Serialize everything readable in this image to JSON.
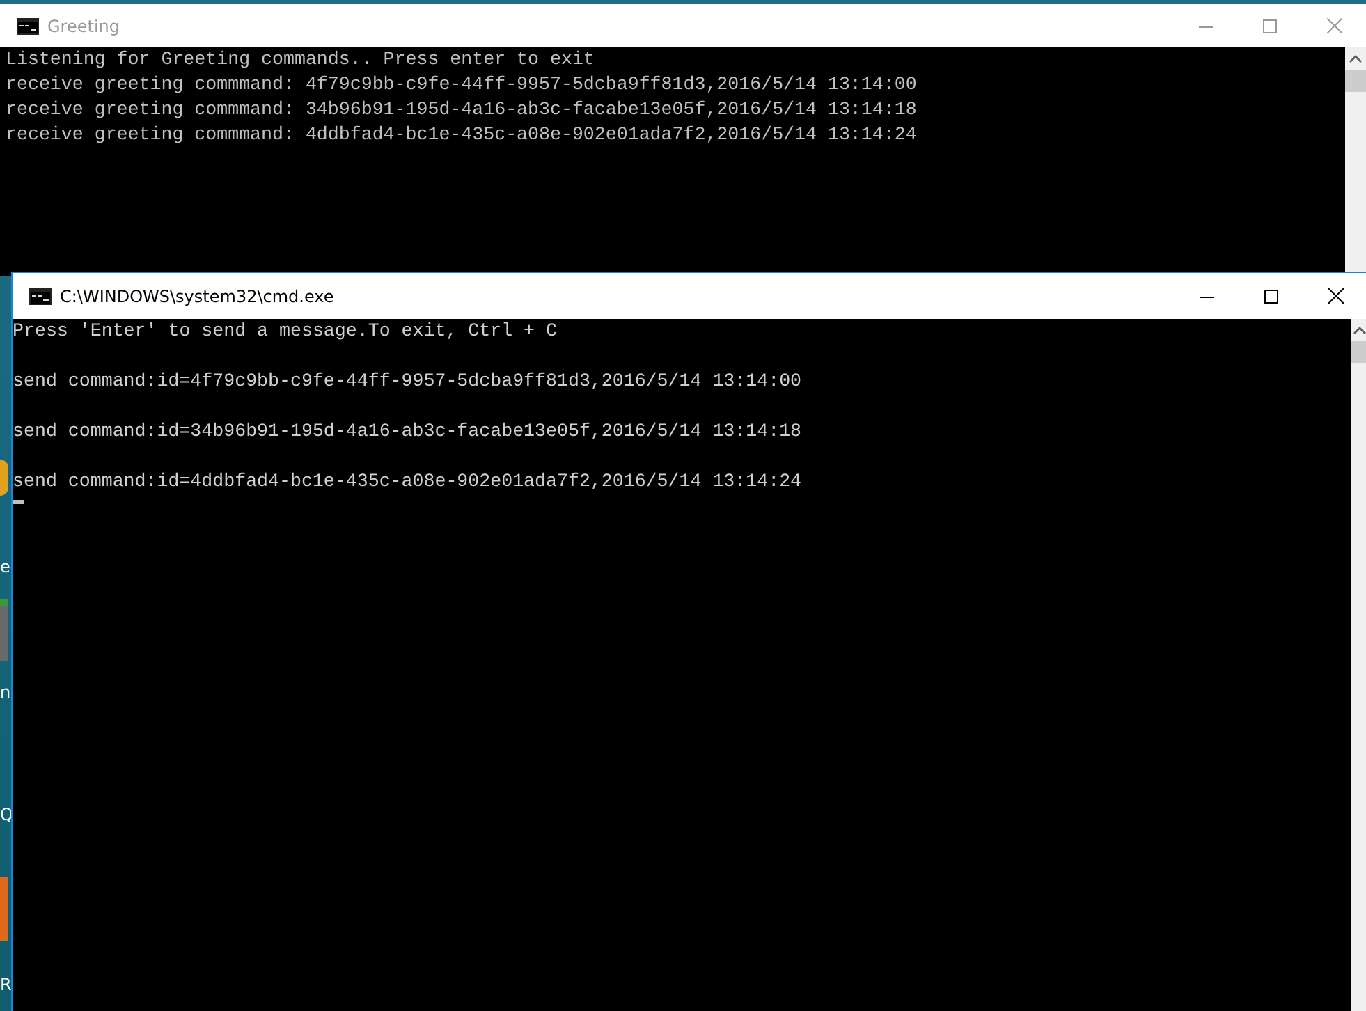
{
  "desktop": {
    "labels": [
      {
        "text": "e"
      },
      {
        "text": "n"
      },
      {
        "text": "Q"
      },
      {
        "text": "R"
      }
    ]
  },
  "windows": [
    {
      "title": "Greeting",
      "active": false,
      "lines": [
        {
          "text": "Listening for Greeting commands.. Press enter to exit",
          "blank_before": false
        },
        {
          "text": "receive greeting commmand: 4f79c9bb-c9fe-44ff-9957-5dcba9ff81d3,2016/5/14 13:14:00",
          "blank_before": false
        },
        {
          "text": "receive greeting commmand: 34b96b91-195d-4a16-ab3c-facabe13e05f,2016/5/14 13:14:18",
          "blank_before": false
        },
        {
          "text": "receive greeting commmand: 4ddbfad4-bc1e-435c-a08e-902e01ada7f2,2016/5/14 13:14:24",
          "blank_before": false
        }
      ],
      "cursor": false
    },
    {
      "title": "C:\\WINDOWS\\system32\\cmd.exe",
      "active": true,
      "lines": [
        {
          "text": "Press 'Enter' to send a message.To exit, Ctrl + C",
          "blank_before": false
        },
        {
          "text": "send command:id=4f79c9bb-c9fe-44ff-9957-5dcba9ff81d3,2016/5/14 13:14:00",
          "blank_before": true
        },
        {
          "text": "send command:id=34b96b91-195d-4a16-ab3c-facabe13e05f,2016/5/14 13:14:18",
          "blank_before": true
        },
        {
          "text": "send command:id=4ddbfad4-bc1e-435c-a08e-902e01ada7f2,2016/5/14 13:14:24",
          "blank_before": true
        }
      ],
      "cursor": true
    }
  ]
}
